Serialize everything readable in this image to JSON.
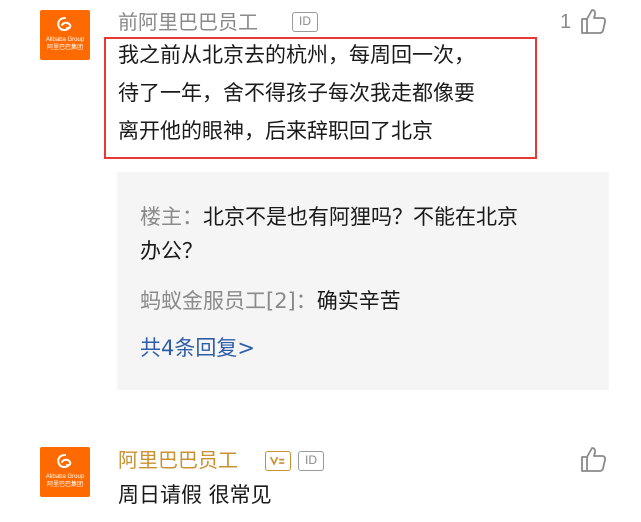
{
  "comments": [
    {
      "avatar": {
        "brand_en": "Alibaba Group",
        "brand_cn": "阿里巴巴集团"
      },
      "username": "前阿里巴巴员工",
      "id_badge": "ID",
      "like_count": "1",
      "text_lines": [
        "我之前从北京去的杭州，每周回一次，",
        "待了一年，舍不得孩子每次我走都像要",
        "离开他的眼神，后来辞职回了北京"
      ],
      "replies": [
        {
          "author": "楼主：",
          "text_lines": [
            "北京不是也有阿狸吗？不能在北京",
            "办公？"
          ]
        },
        {
          "author": "蚂蚁金服员工[2]：",
          "text_lines": [
            "确实辛苦"
          ]
        }
      ],
      "more_replies": "共4条回复>"
    },
    {
      "avatar": {
        "brand_en": "Alibaba Group",
        "brand_cn": "阿里巴巴集团"
      },
      "username": "阿里巴巴员工",
      "id_badge": "ID",
      "text_lines": [
        "周日请假 很常见"
      ]
    }
  ],
  "colors": {
    "avatar_bg": "#ff6a00",
    "highlight": "#e53935",
    "verified_name": "#c9912f",
    "link": "#2f5ea8"
  },
  "icons": [
    "thumbs-up-icon",
    "verified-icon",
    "alibaba-logo-icon"
  ]
}
